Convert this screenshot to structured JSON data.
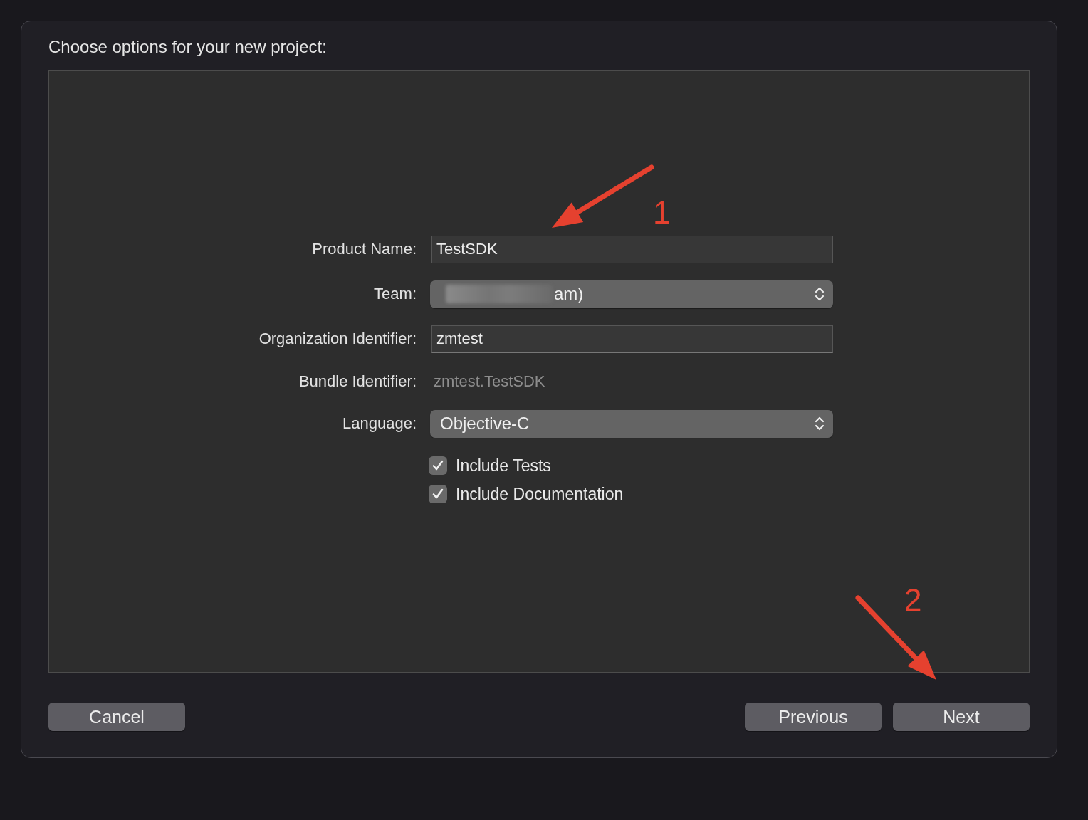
{
  "dialog": {
    "title": "Choose options for your new project:"
  },
  "form": {
    "rows": [
      {
        "kind": "text",
        "label": "Product Name:",
        "value": "TestSDK"
      },
      {
        "kind": "popup",
        "label": "Team:",
        "value": "am)",
        "redacted": true
      },
      {
        "kind": "text",
        "label": "Organization Identifier:",
        "value": "zmtest"
      },
      {
        "kind": "static",
        "label": "Bundle Identifier:",
        "value": "zmtest.TestSDK"
      },
      {
        "kind": "popup",
        "label": "Language:",
        "value": "Objective-C"
      },
      {
        "kind": "checkbox",
        "label": "Include Tests",
        "checked": true
      },
      {
        "kind": "checkbox",
        "label": "Include Documentation",
        "checked": true
      }
    ]
  },
  "buttons": [
    {
      "label": "Cancel"
    },
    {
      "label": "Previous"
    },
    {
      "label": "Next"
    }
  ],
  "annotations": [
    {
      "label": "1"
    },
    {
      "label": "2"
    }
  ]
}
